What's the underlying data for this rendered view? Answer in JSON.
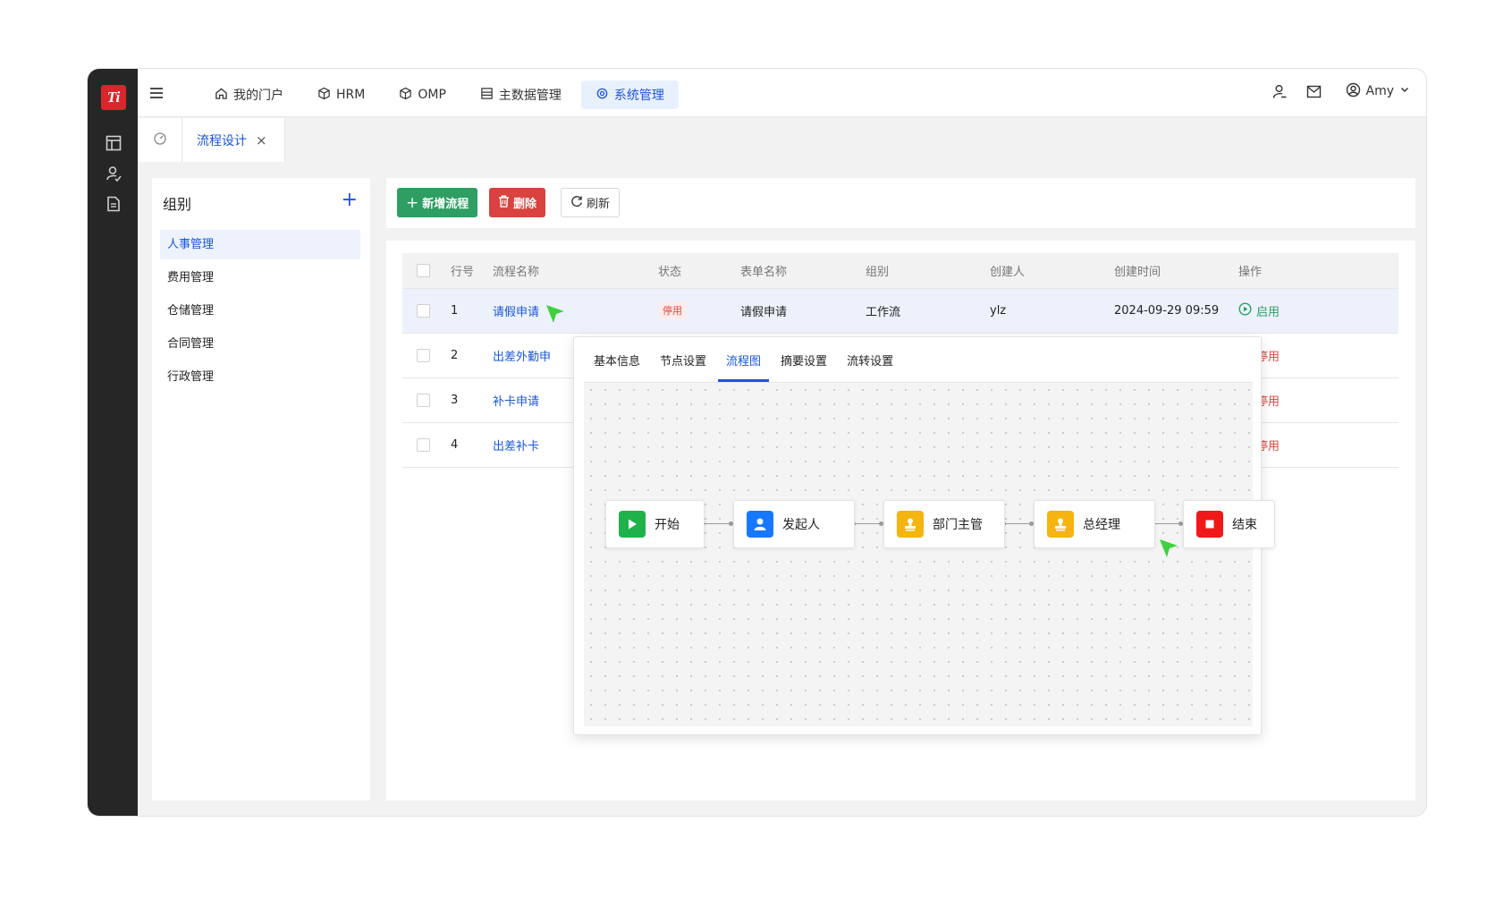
{
  "app": {
    "logo_text": "Ti"
  },
  "nav": [
    {
      "label": "我的门户",
      "icon": "home-icon"
    },
    {
      "label": "HRM",
      "icon": "cube-icon"
    },
    {
      "label": "OMP",
      "icon": "cube-icon"
    },
    {
      "label": "主数据管理",
      "icon": "grid-icon"
    },
    {
      "label": "系统管理",
      "icon": "gear-icon",
      "active": true
    }
  ],
  "user": {
    "name": "Amy"
  },
  "tab": {
    "label": "流程设计",
    "close": "×"
  },
  "groups": {
    "title": "组别",
    "add": "+",
    "items": [
      "人事管理",
      "费用管理",
      "仓储管理",
      "合同管理",
      "行政管理"
    ],
    "active_index": 0
  },
  "toolbar": {
    "add_label": "新增流程",
    "delete_label": "删除",
    "refresh_label": "刷新"
  },
  "table": {
    "headers": [
      "行号",
      "流程名称",
      "状态",
      "表单名称",
      "组别",
      "创建人",
      "创建时间",
      "操作"
    ],
    "rows": [
      {
        "no": "1",
        "name": "请假申请",
        "status": "停用",
        "form": "请假申请",
        "group": "工作流",
        "creator": "ylz",
        "created": "2024-09-29 09:59",
        "action": "启用"
      },
      {
        "no": "2",
        "name": "出差外勤申",
        "action": "停用"
      },
      {
        "no": "3",
        "name": "补卡申请",
        "action": "停用"
      },
      {
        "no": "4",
        "name": "出差补卡",
        "action": "停用"
      }
    ]
  },
  "popup": {
    "tabs": [
      "基本信息",
      "节点设置",
      "流程图",
      "摘要设置",
      "流转设置"
    ],
    "active_tab": 2,
    "nodes": [
      {
        "label": "开始",
        "icon": "play-icon",
        "color": "#1fb24a"
      },
      {
        "label": "发起人",
        "icon": "user-icon",
        "color": "#1677ff"
      },
      {
        "label": "部门主管",
        "icon": "stamp-icon",
        "color": "#f5b40f"
      },
      {
        "label": "总经理",
        "icon": "stamp-icon",
        "color": "#f5b40f"
      },
      {
        "label": "结束",
        "icon": "stop-icon",
        "color": "#f01818"
      }
    ]
  },
  "colors": {
    "accent": "#1a56db",
    "success": "#2e9e63",
    "danger": "#d9423e",
    "cursor": "#3dd13d"
  }
}
